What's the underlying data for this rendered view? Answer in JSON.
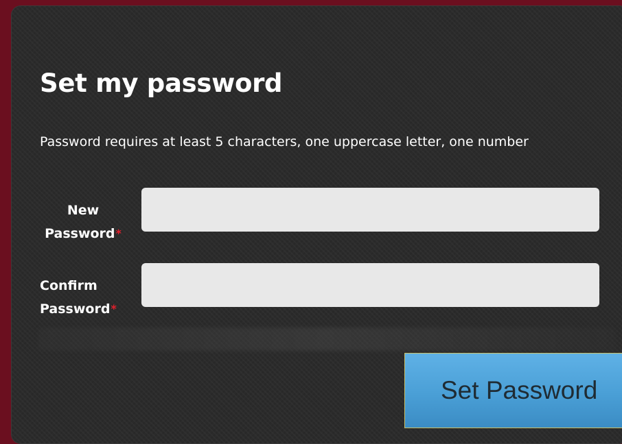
{
  "form": {
    "title": "Set my password",
    "hint": "Password requires at least 5 characters, one uppercase letter, one number",
    "fields": [
      {
        "label_line1": "New",
        "label_line2": "Password",
        "required_mark": "*",
        "value": ""
      },
      {
        "label_line1": "Confirm",
        "label_line2": "Password",
        "required_mark": "*",
        "value": ""
      }
    ],
    "submit_label": "Set Password"
  },
  "colors": {
    "page_background": "#6b0f1f",
    "card_background": "#2b2b2b",
    "input_background": "#e8e8e8",
    "required_mark": "#e2202c",
    "button_accent": "#4a9fd6"
  }
}
